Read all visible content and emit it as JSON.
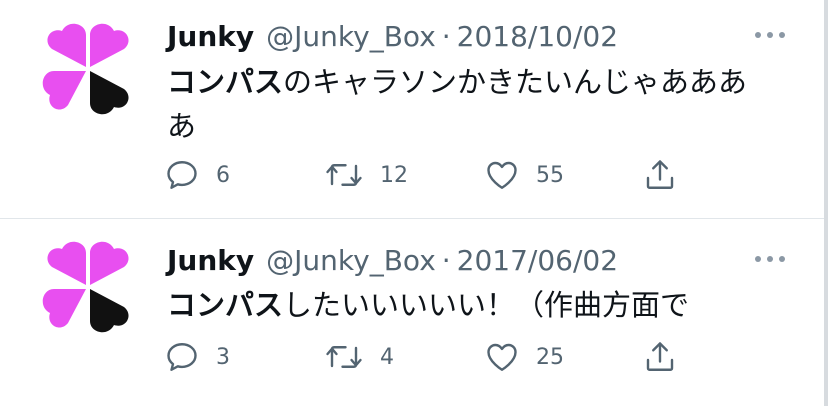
{
  "colors": {
    "avatar_magenta": "#e84ff0",
    "avatar_black": "#111111",
    "muted": "#536471",
    "text": "#0f1419"
  },
  "icons": [
    "clover-avatar",
    "more-icon",
    "reply-icon",
    "retweet-icon",
    "like-icon",
    "share-icon"
  ],
  "tweets": [
    {
      "name": "Junky",
      "handle": "@Junky_Box",
      "separator": "·",
      "date": "2018/10/02",
      "text_bold": "コンパス",
      "text_rest": "のキャラソンかきたいんじゃあああ",
      "text_wrap": "あ",
      "replies": "6",
      "retweets": "12",
      "likes": "55"
    },
    {
      "name": "Junky",
      "handle": "@Junky_Box",
      "separator": "·",
      "date": "2017/06/02",
      "text_bold": "コンパス",
      "text_rest": "したいいいいい！（作曲方面で",
      "replies": "3",
      "retweets": "4",
      "likes": "25"
    }
  ]
}
